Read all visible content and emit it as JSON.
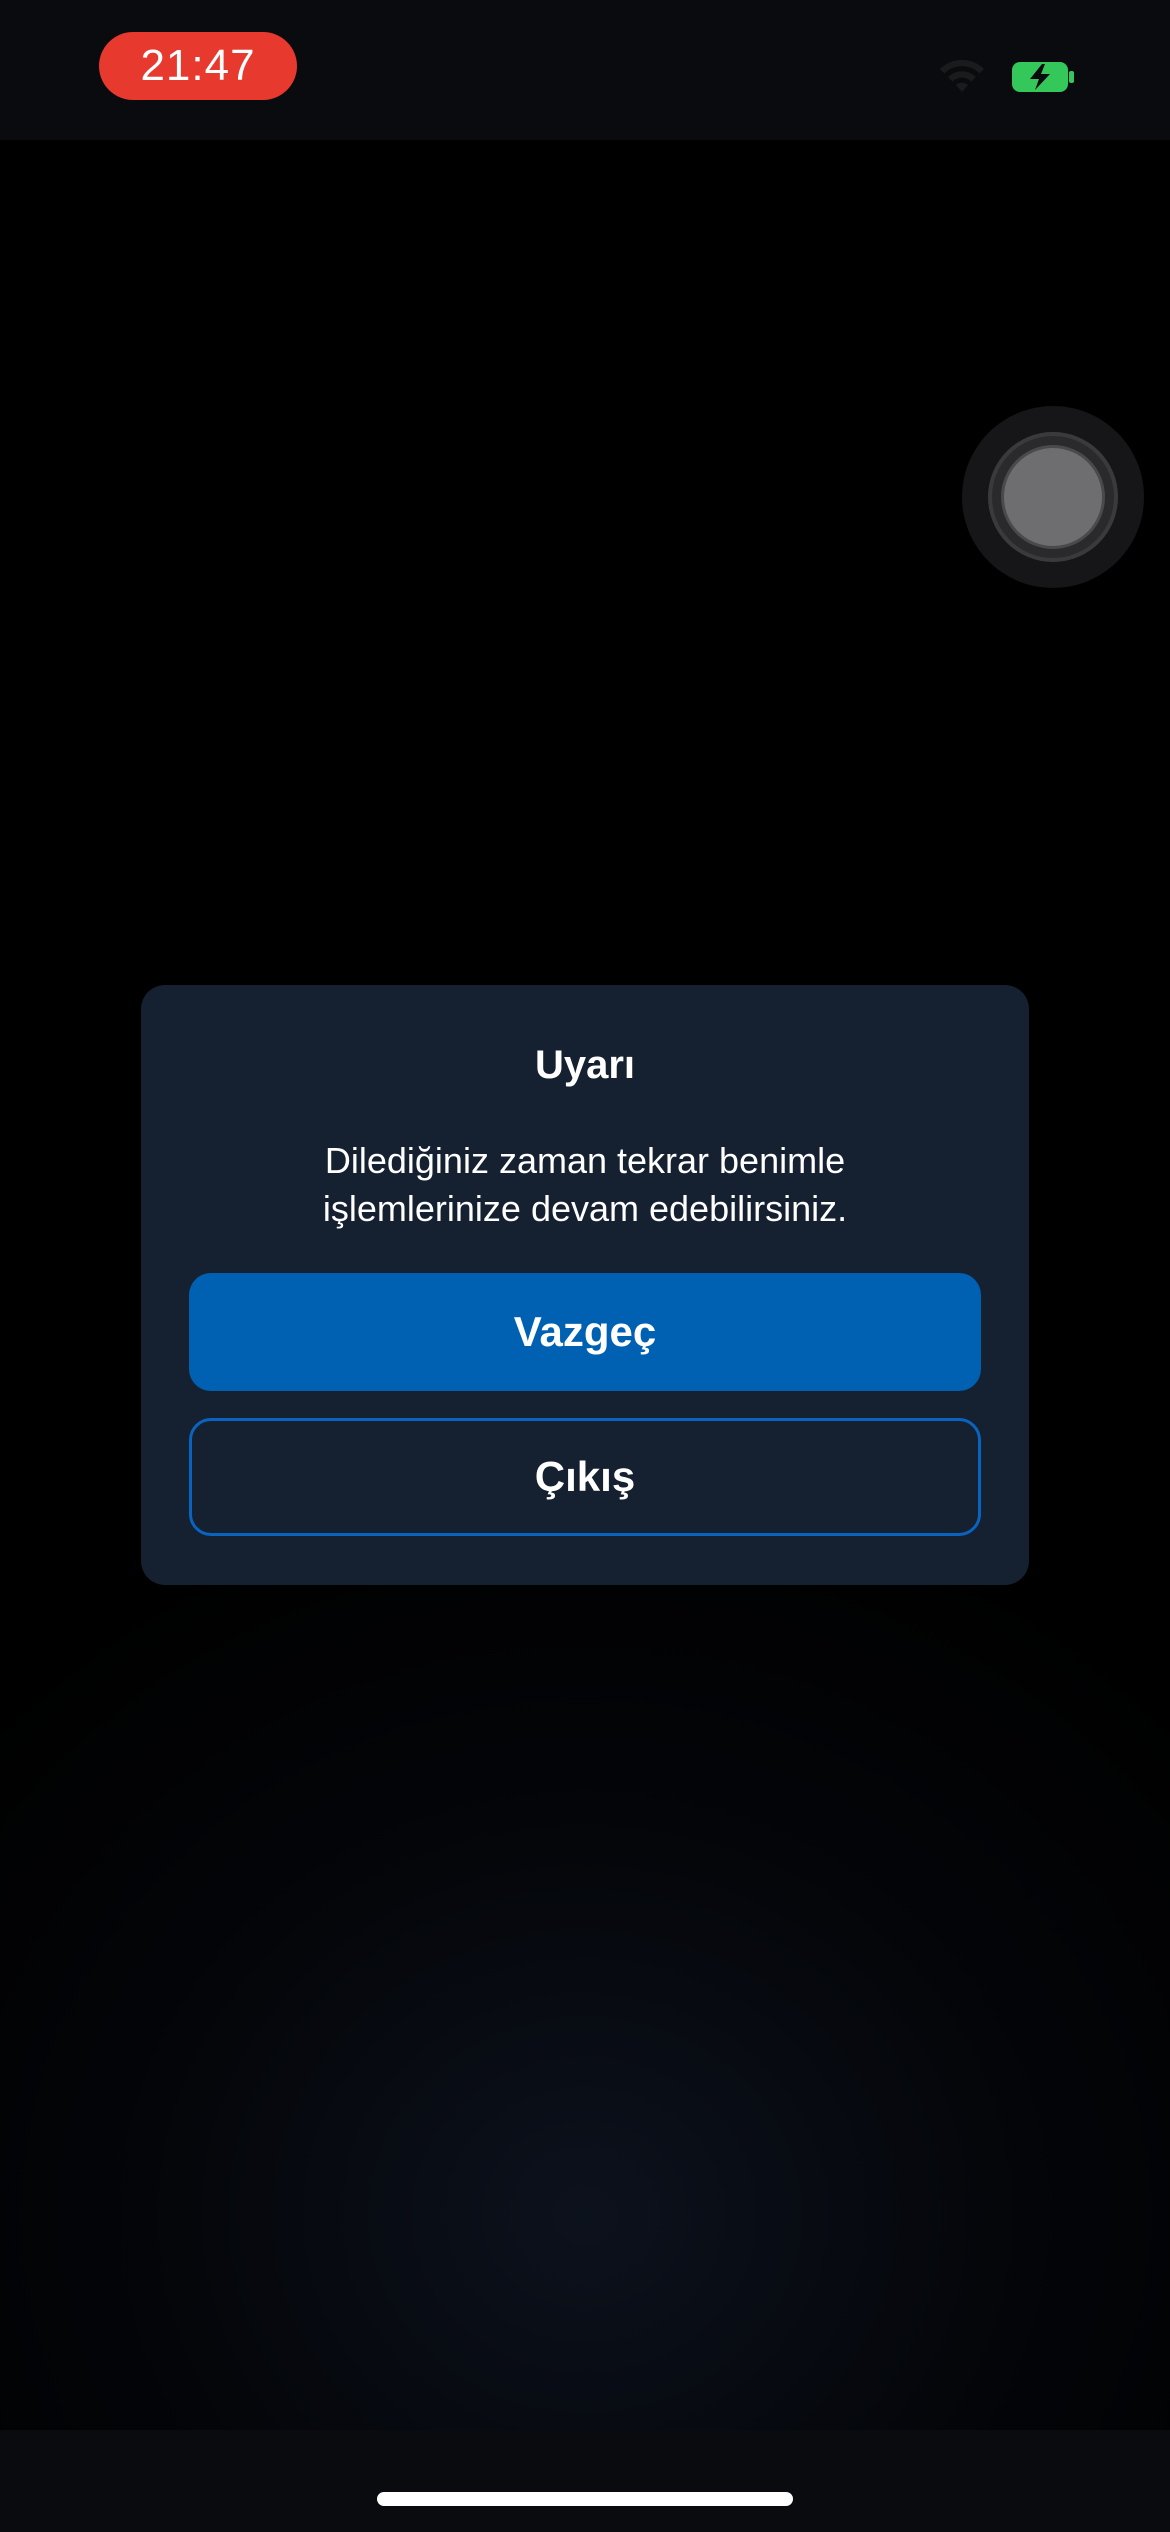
{
  "status_bar": {
    "time": "21:47",
    "icons": [
      "wifi-icon",
      "battery-charging-icon"
    ],
    "time_pill_color": "#e8392f",
    "battery_color": "#34c759"
  },
  "assistive_touch": {
    "icon": "assistive-touch-icon"
  },
  "dialog": {
    "title": "Uyarı",
    "message_line1": "Dilediğiniz zaman tekrar benimle",
    "message_line2": "işlemlerinize devam edebilirsiniz.",
    "primary_button": "Vazgeç",
    "secondary_button": "Çıkış",
    "accent_color": "#0061b3",
    "background_color": "#152030"
  },
  "home_indicator": {
    "icon": "home-indicator"
  }
}
